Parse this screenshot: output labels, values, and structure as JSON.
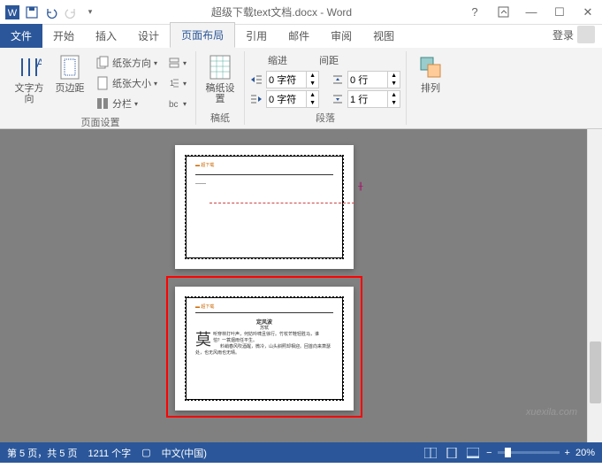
{
  "title": "超级下载text文档.docx - Word",
  "qat": {
    "word": "W"
  },
  "winbtns": {
    "help": "?",
    "full": "⬜",
    "min": "—",
    "max": "☐",
    "close": "✕"
  },
  "tabs": {
    "file": "文件",
    "home": "开始",
    "insert": "插入",
    "design": "设计",
    "layout": "页面布局",
    "ref": "引用",
    "mail": "邮件",
    "review": "审阅",
    "view": "视图",
    "signin": "登录"
  },
  "ribbon": {
    "textdir": "文字方向",
    "margins": "页边距",
    "orientation": "纸张方向",
    "size": "纸张大小",
    "columns": "分栏",
    "pagesetup": "页面设置",
    "稿纸": "稿纸设置",
    "稿纸grp": "稿纸",
    "indent": "缩进",
    "spacing": "间距",
    "left": "0 字符",
    "right": "0 字符",
    "before": "0 行",
    "after": "1 行",
    "paragroup": "段落",
    "arrange": "排列"
  },
  "doc": {
    "header": "超下载",
    "title2": "定风波",
    "author": "苏轼",
    "dropcap": "莫",
    "line1": "听穿林打叶声，何妨吟啸且徐行。竹杖芒鞋轻胜马，谁",
    "line2": "怕？一蓑烟雨任平生。",
    "line3": "料峭春风吹酒醒，微冷，山头斜照却相迎。回首向来萧瑟",
    "line4": "处，也无风雨也无晴。"
  },
  "status": {
    "page": "第 5 页，共 5 页",
    "words": "1211 个字",
    "lang": "中文(中国)",
    "zoom": "20%"
  },
  "watermark": "xuexila.com"
}
